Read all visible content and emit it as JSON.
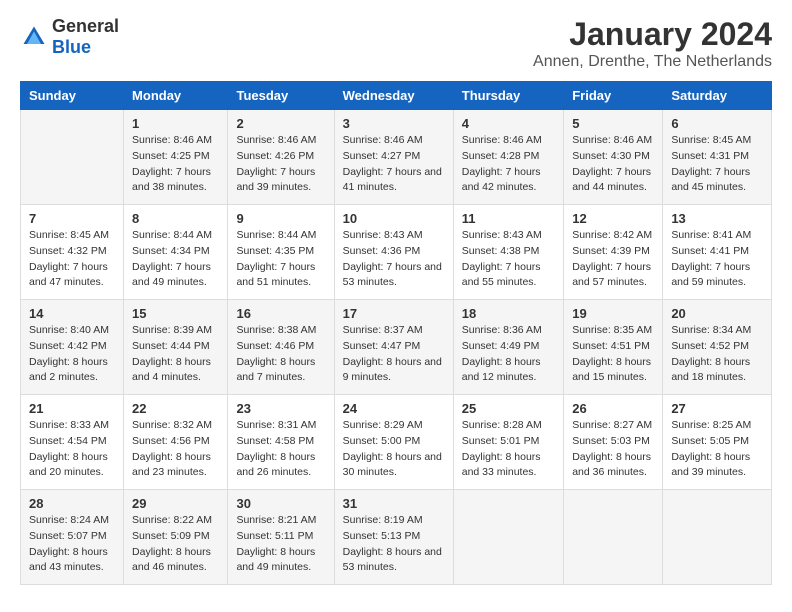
{
  "header": {
    "logo_general": "General",
    "logo_blue": "Blue",
    "month": "January 2024",
    "location": "Annen, Drenthe, The Netherlands"
  },
  "days_of_week": [
    "Sunday",
    "Monday",
    "Tuesday",
    "Wednesday",
    "Thursday",
    "Friday",
    "Saturday"
  ],
  "weeks": [
    [
      {
        "day": "",
        "sunrise": "",
        "sunset": "",
        "daylight": ""
      },
      {
        "day": "1",
        "sunrise": "Sunrise: 8:46 AM",
        "sunset": "Sunset: 4:25 PM",
        "daylight": "Daylight: 7 hours and 38 minutes."
      },
      {
        "day": "2",
        "sunrise": "Sunrise: 8:46 AM",
        "sunset": "Sunset: 4:26 PM",
        "daylight": "Daylight: 7 hours and 39 minutes."
      },
      {
        "day": "3",
        "sunrise": "Sunrise: 8:46 AM",
        "sunset": "Sunset: 4:27 PM",
        "daylight": "Daylight: 7 hours and 41 minutes."
      },
      {
        "day": "4",
        "sunrise": "Sunrise: 8:46 AM",
        "sunset": "Sunset: 4:28 PM",
        "daylight": "Daylight: 7 hours and 42 minutes."
      },
      {
        "day": "5",
        "sunrise": "Sunrise: 8:46 AM",
        "sunset": "Sunset: 4:30 PM",
        "daylight": "Daylight: 7 hours and 44 minutes."
      },
      {
        "day": "6",
        "sunrise": "Sunrise: 8:45 AM",
        "sunset": "Sunset: 4:31 PM",
        "daylight": "Daylight: 7 hours and 45 minutes."
      }
    ],
    [
      {
        "day": "7",
        "sunrise": "Sunrise: 8:45 AM",
        "sunset": "Sunset: 4:32 PM",
        "daylight": "Daylight: 7 hours and 47 minutes."
      },
      {
        "day": "8",
        "sunrise": "Sunrise: 8:44 AM",
        "sunset": "Sunset: 4:34 PM",
        "daylight": "Daylight: 7 hours and 49 minutes."
      },
      {
        "day": "9",
        "sunrise": "Sunrise: 8:44 AM",
        "sunset": "Sunset: 4:35 PM",
        "daylight": "Daylight: 7 hours and 51 minutes."
      },
      {
        "day": "10",
        "sunrise": "Sunrise: 8:43 AM",
        "sunset": "Sunset: 4:36 PM",
        "daylight": "Daylight: 7 hours and 53 minutes."
      },
      {
        "day": "11",
        "sunrise": "Sunrise: 8:43 AM",
        "sunset": "Sunset: 4:38 PM",
        "daylight": "Daylight: 7 hours and 55 minutes."
      },
      {
        "day": "12",
        "sunrise": "Sunrise: 8:42 AM",
        "sunset": "Sunset: 4:39 PM",
        "daylight": "Daylight: 7 hours and 57 minutes."
      },
      {
        "day": "13",
        "sunrise": "Sunrise: 8:41 AM",
        "sunset": "Sunset: 4:41 PM",
        "daylight": "Daylight: 7 hours and 59 minutes."
      }
    ],
    [
      {
        "day": "14",
        "sunrise": "Sunrise: 8:40 AM",
        "sunset": "Sunset: 4:42 PM",
        "daylight": "Daylight: 8 hours and 2 minutes."
      },
      {
        "day": "15",
        "sunrise": "Sunrise: 8:39 AM",
        "sunset": "Sunset: 4:44 PM",
        "daylight": "Daylight: 8 hours and 4 minutes."
      },
      {
        "day": "16",
        "sunrise": "Sunrise: 8:38 AM",
        "sunset": "Sunset: 4:46 PM",
        "daylight": "Daylight: 8 hours and 7 minutes."
      },
      {
        "day": "17",
        "sunrise": "Sunrise: 8:37 AM",
        "sunset": "Sunset: 4:47 PM",
        "daylight": "Daylight: 8 hours and 9 minutes."
      },
      {
        "day": "18",
        "sunrise": "Sunrise: 8:36 AM",
        "sunset": "Sunset: 4:49 PM",
        "daylight": "Daylight: 8 hours and 12 minutes."
      },
      {
        "day": "19",
        "sunrise": "Sunrise: 8:35 AM",
        "sunset": "Sunset: 4:51 PM",
        "daylight": "Daylight: 8 hours and 15 minutes."
      },
      {
        "day": "20",
        "sunrise": "Sunrise: 8:34 AM",
        "sunset": "Sunset: 4:52 PM",
        "daylight": "Daylight: 8 hours and 18 minutes."
      }
    ],
    [
      {
        "day": "21",
        "sunrise": "Sunrise: 8:33 AM",
        "sunset": "Sunset: 4:54 PM",
        "daylight": "Daylight: 8 hours and 20 minutes."
      },
      {
        "day": "22",
        "sunrise": "Sunrise: 8:32 AM",
        "sunset": "Sunset: 4:56 PM",
        "daylight": "Daylight: 8 hours and 23 minutes."
      },
      {
        "day": "23",
        "sunrise": "Sunrise: 8:31 AM",
        "sunset": "Sunset: 4:58 PM",
        "daylight": "Daylight: 8 hours and 26 minutes."
      },
      {
        "day": "24",
        "sunrise": "Sunrise: 8:29 AM",
        "sunset": "Sunset: 5:00 PM",
        "daylight": "Daylight: 8 hours and 30 minutes."
      },
      {
        "day": "25",
        "sunrise": "Sunrise: 8:28 AM",
        "sunset": "Sunset: 5:01 PM",
        "daylight": "Daylight: 8 hours and 33 minutes."
      },
      {
        "day": "26",
        "sunrise": "Sunrise: 8:27 AM",
        "sunset": "Sunset: 5:03 PM",
        "daylight": "Daylight: 8 hours and 36 minutes."
      },
      {
        "day": "27",
        "sunrise": "Sunrise: 8:25 AM",
        "sunset": "Sunset: 5:05 PM",
        "daylight": "Daylight: 8 hours and 39 minutes."
      }
    ],
    [
      {
        "day": "28",
        "sunrise": "Sunrise: 8:24 AM",
        "sunset": "Sunset: 5:07 PM",
        "daylight": "Daylight: 8 hours and 43 minutes."
      },
      {
        "day": "29",
        "sunrise": "Sunrise: 8:22 AM",
        "sunset": "Sunset: 5:09 PM",
        "daylight": "Daylight: 8 hours and 46 minutes."
      },
      {
        "day": "30",
        "sunrise": "Sunrise: 8:21 AM",
        "sunset": "Sunset: 5:11 PM",
        "daylight": "Daylight: 8 hours and 49 minutes."
      },
      {
        "day": "31",
        "sunrise": "Sunrise: 8:19 AM",
        "sunset": "Sunset: 5:13 PM",
        "daylight": "Daylight: 8 hours and 53 minutes."
      },
      {
        "day": "",
        "sunrise": "",
        "sunset": "",
        "daylight": ""
      },
      {
        "day": "",
        "sunrise": "",
        "sunset": "",
        "daylight": ""
      },
      {
        "day": "",
        "sunrise": "",
        "sunset": "",
        "daylight": ""
      }
    ]
  ]
}
